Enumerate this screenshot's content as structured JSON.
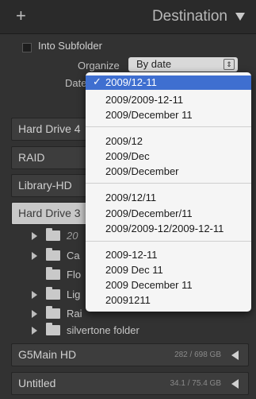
{
  "header": {
    "plus_icon": "+",
    "title": "Destination"
  },
  "subfolder": {
    "label": "Into Subfolder",
    "checked": false
  },
  "organize": {
    "label": "Organize",
    "value": "By date"
  },
  "date_format": {
    "label": "Date"
  },
  "volumes": [
    {
      "name": "Hard Drive 4",
      "usage": "",
      "state": "collapsed"
    },
    {
      "name": "RAID",
      "usage": "",
      "state": "collapsed"
    },
    {
      "name": "Library-HD",
      "usage": "",
      "state": "collapsed"
    },
    {
      "name": "Hard Drive 3",
      "usage": "",
      "state": "expanded"
    },
    {
      "name": "G5Main HD",
      "usage": "282 / 698 GB",
      "state": "collapsed"
    },
    {
      "name": "Untitled",
      "usage": "34.1 / 75.4 GB",
      "state": "collapsed"
    }
  ],
  "folders": [
    {
      "name": "20",
      "italic": true,
      "expandable": true
    },
    {
      "name": "Ca",
      "italic": false,
      "expandable": true
    },
    {
      "name": "Flo",
      "italic": false,
      "expandable": false
    },
    {
      "name": "Lig",
      "italic": false,
      "expandable": true
    },
    {
      "name": "Rai",
      "italic": false,
      "expandable": true
    },
    {
      "name": "silvertone folder",
      "italic": false,
      "expandable": true
    }
  ],
  "date_menu": {
    "selected": "2009/12-11",
    "groups": [
      [
        "2009/12-11",
        "2009/2009-12-11",
        "2009/December 11"
      ],
      [
        "2009/12",
        "2009/Dec",
        "2009/December"
      ],
      [
        "2009/12/11",
        "2009/December/11",
        "2009/2009-12/2009-12-11"
      ],
      [
        "2009-12-11",
        "2009 Dec 11",
        "2009 December 11",
        "20091211"
      ]
    ]
  }
}
